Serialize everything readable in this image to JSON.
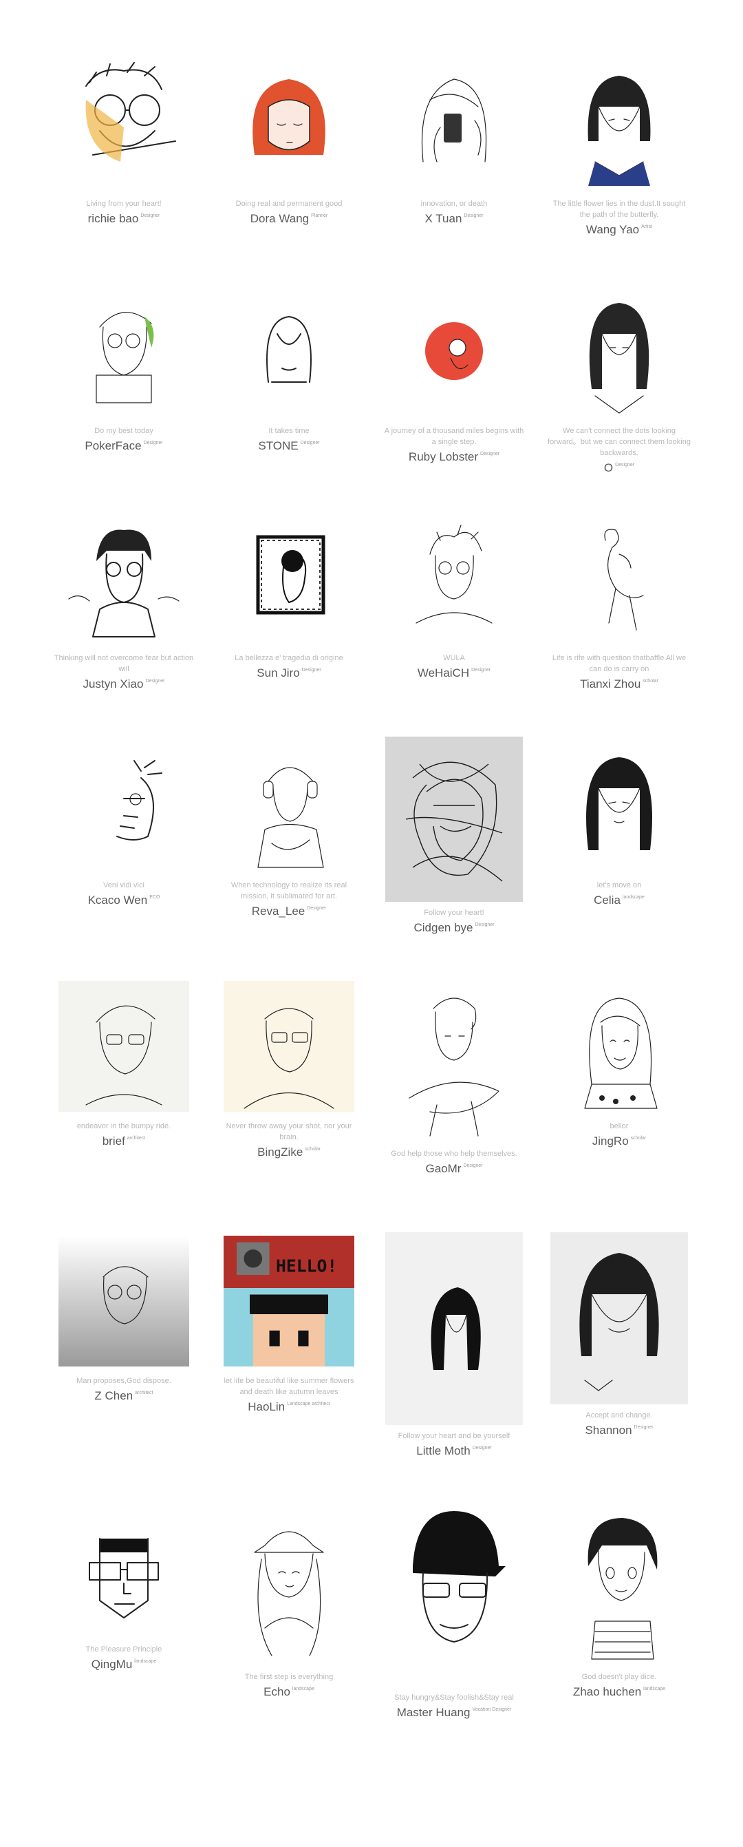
{
  "people": [
    {
      "quote": "Living from your heart!",
      "name": "richie bao",
      "role": "Designer",
      "icon": "sketch-portrait-glasses-icon"
    },
    {
      "quote": "Doing real and permanent good",
      "name": "Dora Wang",
      "role": "Planner",
      "icon": "sketch-portrait-red-hair-icon",
      "accent": "#e0532e"
    },
    {
      "quote": "innovation, or death",
      "name": "X Tuan",
      "role": "Designer",
      "icon": "sketch-portrait-phone-icon"
    },
    {
      "quote": "The little flower lies in the dust.It sought the path of the butterfly.",
      "name": "Wang Yao",
      "role": "Artist",
      "icon": "sketch-portrait-bob-hair-icon"
    },
    {
      "quote": "Do my best today",
      "name": "PokerFace",
      "role": "Designer",
      "icon": "sketch-portrait-sign-icon"
    },
    {
      "quote": "It takes time",
      "name": "STONE",
      "role": "Designer",
      "icon": "line-portrait-minimal-icon"
    },
    {
      "quote": "A journey of a thousand miles begins with a single step.",
      "name": "Ruby Lobster",
      "role": "Designer",
      "icon": "red-circle-portrait-icon",
      "accent": "#e84a3a"
    },
    {
      "quote": "We can't connect the dots looking forward。but we can connect them looking backwards.",
      "name": "O",
      "role": "Designer",
      "icon": "sketch-portrait-long-hair-icon"
    },
    {
      "quote": "Thinking will not overcome fear but action will",
      "name": "Justyn Xiao",
      "role": "Designer",
      "icon": "sketch-portrait-signature-icon"
    },
    {
      "quote": "La bellezza e' tragedia di origine",
      "name": "Sun Jiro",
      "role": "Designer",
      "icon": "framed-profile-portrait-icon"
    },
    {
      "quote": "WULA",
      "name": "WeHaiCH",
      "role": "Designer",
      "icon": "sketch-portrait-messy-hair-icon"
    },
    {
      "quote": "Life is rife with question thatbaffle All we can do is carry on",
      "name": "Tianxi Zhou",
      "role": "scholar",
      "icon": "sketch-portrait-looking-up-icon"
    },
    {
      "quote": "Veni vidi vici",
      "name": "Kcaco Wen",
      "role": "ECO",
      "icon": "sketch-portrait-half-face-icon"
    },
    {
      "quote": "When technology to realize its real mission, it sublimated for art.",
      "name": "Reva_Lee",
      "role": "Designer",
      "icon": "sketch-portrait-headphones-icon"
    },
    {
      "quote": "Follow your heart!",
      "name": "Cidgen bye",
      "role": "Designer",
      "icon": "scribble-portrait-icon"
    },
    {
      "quote": "let's move on",
      "name": "Celia",
      "role": "landscape",
      "icon": "sketch-portrait-black-hair-icon"
    },
    {
      "quote": "endeavor in the bumpy ride.",
      "name": "brief",
      "role": "architect",
      "icon": "pencil-portrait-glasses-icon"
    },
    {
      "quote": "Never throw away your shot, nor your brain.",
      "name": "BingZike",
      "role": "scholar",
      "icon": "pencil-portrait-man-icon"
    },
    {
      "quote": "God help those who help themselves.",
      "name": "GaoMr",
      "role": "Designer",
      "icon": "sketch-portrait-scarf-icon"
    },
    {
      "quote": "bellor",
      "name": "JingRo",
      "role": "scholar",
      "icon": "sketch-portrait-girl-icon"
    },
    {
      "quote": "Man proposes,God dispose.",
      "name": "Z Chen",
      "role": "architect",
      "icon": "sketch-portrait-grey-icon"
    },
    {
      "quote": "let life be beautiful like summer flowers and death like autumn leaves",
      "name": "HaoLin",
      "role": "Landscape architect",
      "icon": "pixel-art-portrait-icon",
      "accent": "#b2302a",
      "banner": "HELLO!"
    },
    {
      "quote": "Follow your heart and be yourself",
      "name": "Little Moth",
      "role": "Designer",
      "icon": "ink-portrait-long-hair-icon"
    },
    {
      "quote": "Accept and change.",
      "name": "Shannon",
      "role": "Designer",
      "icon": "ink-portrait-bangs-icon"
    },
    {
      "quote": "The Pleasure Principle",
      "name": "QingMu",
      "role": "landscape",
      "icon": "geometric-portrait-glasses-icon"
    },
    {
      "quote": "The first step is everything",
      "name": "Echo",
      "role": "landscape",
      "icon": "sketch-portrait-bucket-hat-icon"
    },
    {
      "quote": "Stay hungry&Stay foolish&Stay real",
      "name": "Master Huang",
      "role": "Vocation Designer",
      "icon": "portrait-cap-glasses-icon"
    },
    {
      "quote": "God doesn't play dice.",
      "name": "Zhao huchen",
      "role": "landscape",
      "icon": "manga-portrait-boy-icon"
    }
  ]
}
